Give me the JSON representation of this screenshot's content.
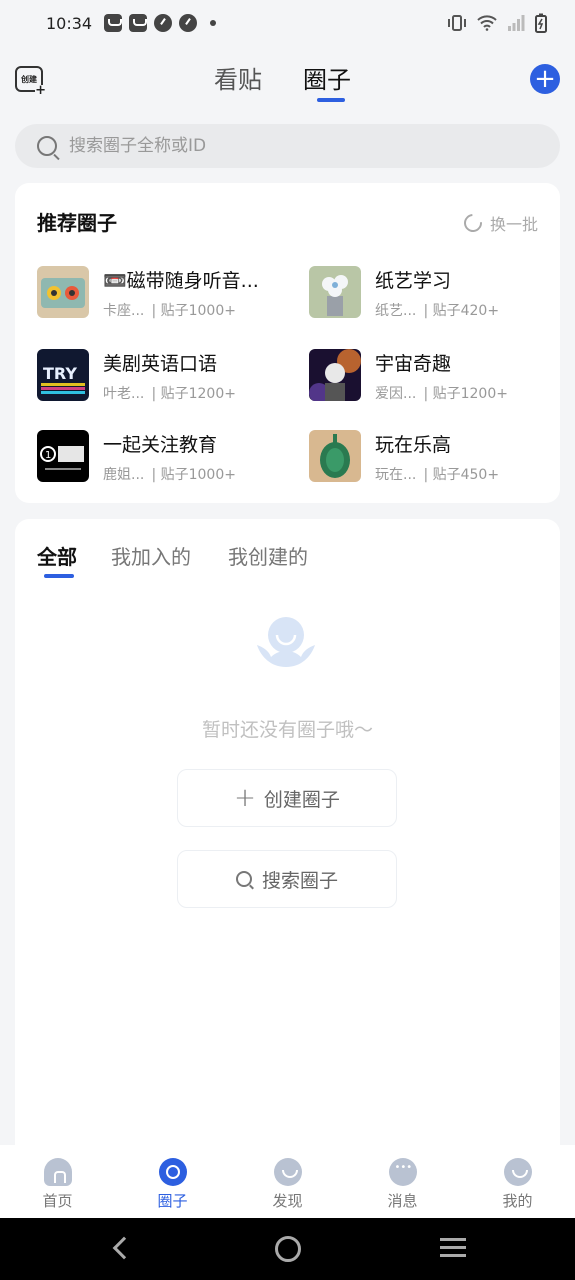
{
  "status": {
    "time": "10:34"
  },
  "header": {
    "create_label": "创建",
    "tabs": [
      "看贴",
      "圈子"
    ],
    "active_tab": 1
  },
  "search": {
    "placeholder": "搜索圈子全称或ID"
  },
  "recommend": {
    "title": "推荐圈子",
    "refresh_label": "换一批",
    "items": [
      {
        "name": "📼磁带随身听音...",
        "owner": "卡座...",
        "posts": "| 贴子1000+"
      },
      {
        "name": "纸艺学习",
        "owner": "纸艺...",
        "posts": "| 贴子420+"
      },
      {
        "name": "美剧英语口语",
        "owner": "叶老...",
        "posts": "| 贴子1200+"
      },
      {
        "name": "宇宙奇趣",
        "owner": "爱因...",
        "posts": "| 贴子1200+"
      },
      {
        "name": "一起关注教育",
        "owner": "鹿姐...",
        "posts": "| 贴子1000+"
      },
      {
        "name": "玩在乐高",
        "owner": "玩在...",
        "posts": "| 贴子450+"
      }
    ]
  },
  "my_circles": {
    "tabs": [
      "全部",
      "我加入的",
      "我创建的"
    ],
    "active_tab": 0,
    "empty_text": "暂时还没有圈子哦～",
    "create_button": "创建圈子",
    "search_button": "搜索圈子"
  },
  "bottom_nav": {
    "items": [
      "首页",
      "圈子",
      "发现",
      "消息",
      "我的"
    ],
    "active": 1
  },
  "colors": {
    "accent": "#2d5fe0",
    "nav_inactive": "#b9c2d2"
  }
}
